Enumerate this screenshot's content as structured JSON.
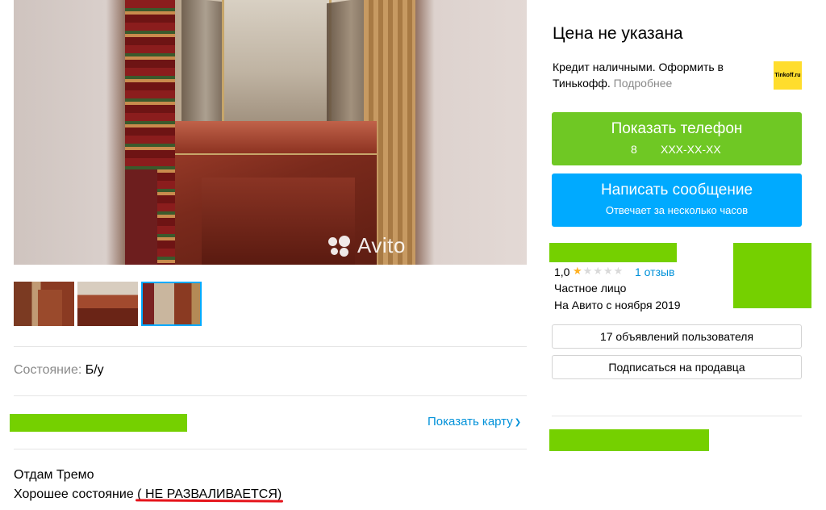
{
  "gallery": {
    "watermark": "Avito",
    "thumbnails": [
      "photo-1",
      "photo-2",
      "photo-3"
    ],
    "selected_index": 2
  },
  "params": {
    "condition_label": "Состояние:",
    "condition_value": "Б/у"
  },
  "location": {
    "show_map": "Показать карту"
  },
  "description": {
    "lines": [
      "Отдам Тремо",
      "Хорошее состояние ( НЕ РАЗВАЛИВАЕТСЯ)"
    ]
  },
  "sidebar": {
    "price": "Цена не указана",
    "credit": {
      "text": "Кредит наличными. Оформить в Тинькофф.",
      "more": "Подробнее",
      "logo_text": "Tinkoff.ru"
    },
    "phone_button": {
      "label": "Показать телефон",
      "prefix": "8",
      "masked": "XXX-XX-XX"
    },
    "message_button": {
      "label": "Написать сообщение",
      "sub": "Отвечает за несколько часов"
    },
    "seller": {
      "rating": "1,0",
      "stars_filled": 1,
      "stars_total": 5,
      "reviews": "1 отзыв",
      "type": "Частное лицо",
      "since": "На Авито с ноября 2019"
    },
    "ads_button": "17 объявлений пользователя",
    "subscribe_button": "Подписаться на продавца"
  },
  "colors": {
    "accent_green": "#6fc824",
    "accent_blue": "#00aaff",
    "link_blue": "#0091d9",
    "redaction_green": "#75d000",
    "annotation_red": "#e5141b",
    "star_yellow": "#ffb021"
  }
}
